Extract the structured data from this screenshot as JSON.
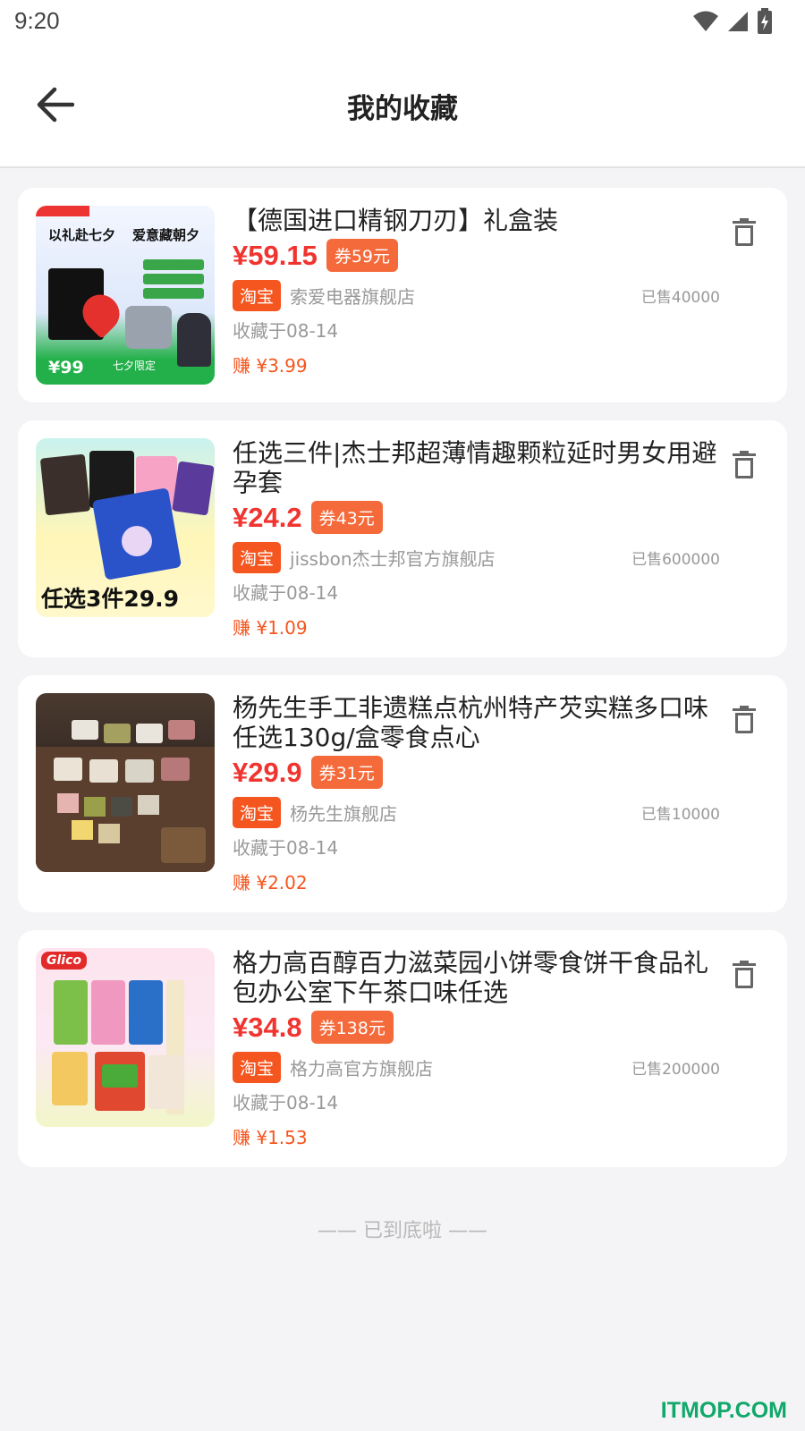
{
  "status": {
    "time": "9:20"
  },
  "header": {
    "title": "我的收藏"
  },
  "items": [
    {
      "title": "【德国进口精钢刀刃】礼盒装",
      "price": "¥59.15",
      "coupon": "券59元",
      "platform": "淘宝",
      "shop": "索爱电器旗舰店",
      "sold": "已售40000",
      "fav_date": "收藏于08-14",
      "earn": "赚 ¥3.99",
      "thumb": {
        "head1": "以礼赴七夕",
        "head2": "爱意藏朝夕",
        "price_tag": "¥99",
        "promo": "七夕限定"
      }
    },
    {
      "title": "任选三件|杰士邦超薄情趣颗粒延时男女用避孕套",
      "price": "¥24.2",
      "coupon": "券43元",
      "platform": "淘宝",
      "shop": "jissbon杰士邦官方旗舰店",
      "sold": "已售600000",
      "fav_date": "收藏于08-14",
      "earn": "赚 ¥1.09",
      "thumb": {
        "banner": "任选3件29.9"
      }
    },
    {
      "title": "杨先生手工非遗糕点杭州特产芡实糕多口味任选130g/盒零食点心",
      "price": "¥29.9",
      "coupon": "券31元",
      "platform": "淘宝",
      "shop": "杨先生旗舰店",
      "sold": "已售10000",
      "fav_date": "收藏于08-14",
      "earn": "赚 ¥2.02",
      "thumb": {}
    },
    {
      "title": "格力高百醇百力滋菜园小饼零食饼干食品礼包办公室下午茶口味任选",
      "price": "¥34.8",
      "coupon": "券138元",
      "platform": "淘宝",
      "shop": "格力高官方旗舰店",
      "sold": "已售200000",
      "fav_date": "收藏于08-14",
      "earn": "赚 ¥1.53",
      "thumb": {
        "brand": "Glico"
      }
    }
  ],
  "footer": {
    "end_tip": "—— 已到底啦 ——"
  },
  "watermark": "ITMOP.COM",
  "colors": {
    "price": "#f0342f",
    "coupon": "#f56a3b",
    "platform": "#f5551e",
    "watermark": "#12a86b"
  }
}
